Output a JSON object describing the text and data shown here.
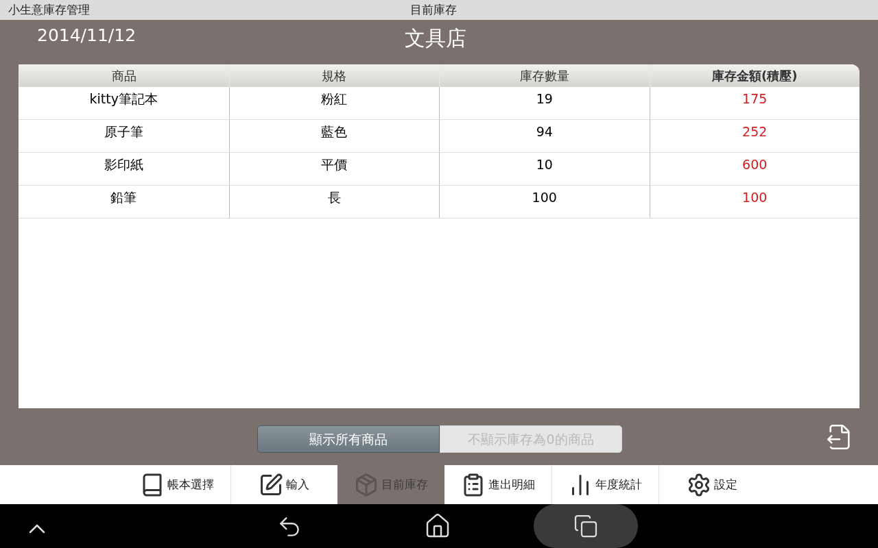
{
  "status_bar": {
    "app_title": "小生意庫存管理",
    "screen_title": "目前庫存"
  },
  "header": {
    "date": "2014/11/12",
    "store": "文具店"
  },
  "table": {
    "columns": [
      "商品",
      "規格",
      "庫存數量",
      "庫存金額(積壓)"
    ],
    "rows": [
      [
        "kitty筆記本",
        "粉紅",
        "19",
        "175"
      ],
      [
        "原子筆",
        "藍色",
        "94",
        "252"
      ],
      [
        "影印紙",
        "平價",
        "10",
        "600"
      ],
      [
        "鉛筆",
        "長",
        "100",
        "100"
      ]
    ]
  },
  "filter": [
    {
      "label": "顯示所有商品",
      "selected": true
    },
    {
      "label": "不顯示庫存為0的商品",
      "selected": false
    }
  ],
  "tabs": [
    {
      "label": "帳本選擇",
      "kind": "book",
      "selected": false
    },
    {
      "label": "輸入",
      "kind": "edit",
      "selected": false
    },
    {
      "label": "目前庫存",
      "kind": "box",
      "selected": true
    },
    {
      "label": "進出明細",
      "kind": "clipboard",
      "selected": false
    },
    {
      "label": "年度統計",
      "kind": "chart",
      "selected": false
    },
    {
      "label": "設定",
      "kind": "settings",
      "selected": false
    }
  ]
}
